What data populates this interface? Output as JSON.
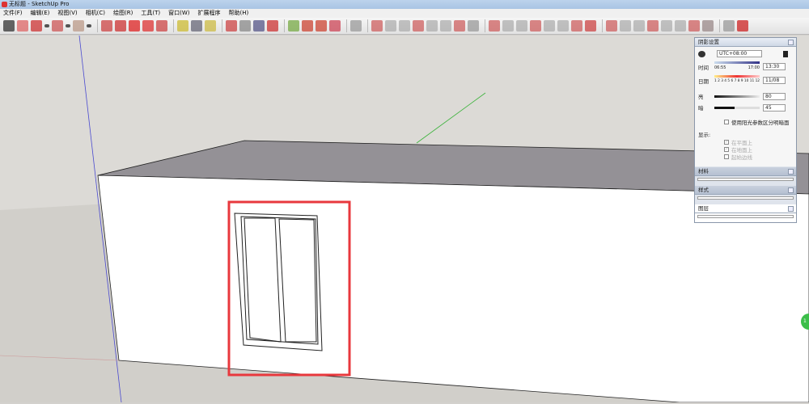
{
  "window": {
    "title": "无标题 - SketchUp Pro"
  },
  "menu": [
    "文件(F)",
    "编辑(E)",
    "视图(V)",
    "相机(C)",
    "绘图(R)",
    "工具(T)",
    "窗口(W)",
    "扩展程序",
    "帮助(H)"
  ],
  "toolbar": {
    "icons": [
      "select-icon",
      "eraser-icon",
      "pencil-icon",
      "dropdown-icon",
      "arc-icon",
      "dropdown-icon",
      "rectangle-icon",
      "dropdown-icon",
      "push-pull-icon",
      "follow-me-icon",
      "move-icon",
      "rotate-icon",
      "scale-icon",
      "tape-measure-icon",
      "text-icon",
      "paint-bucket-icon",
      "orbit-icon",
      "pan-icon",
      "zoom-icon",
      "zoom-extents-icon",
      "book-icon",
      "component-icon",
      "warehouse-icon",
      "export-icon",
      "section-icons",
      "sandbox-icons",
      "solid-tools-icons",
      "style-icons",
      "extension-icon",
      "ruby-icon"
    ]
  },
  "panel": {
    "title": "阴影设置",
    "timezone": "UTC+08:00",
    "time_label": "时间",
    "time_start": "06:55",
    "time_end": "17:00",
    "time_value": "13:30",
    "date_label": "日期",
    "months": "1 2 3 4 5 6 7 8 9 10 11 12",
    "date_value": "11/08",
    "light_label": "亮",
    "light_value": "80",
    "dark_label": "暗",
    "dark_value": "45",
    "use_sun_label": "使用阳光参数区分明暗面",
    "display_label": "显示:",
    "display_options": [
      {
        "label": "在平面上",
        "checked": true
      },
      {
        "label": "在地面上",
        "checked": true
      },
      {
        "label": "起始边线",
        "checked": false
      }
    ],
    "collapsed": [
      "材料",
      "样式",
      "图层"
    ]
  },
  "colors": {
    "highlight": "#e8383d",
    "sky": "#dedbd7",
    "ground": "#cfccc7",
    "roof": "#949196"
  },
  "badge": "1"
}
